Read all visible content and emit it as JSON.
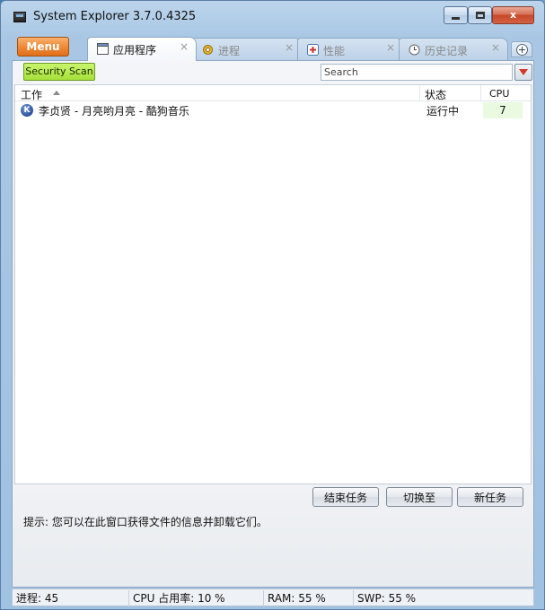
{
  "window": {
    "title": "System Explorer 3.7.0.4325",
    "controls": {
      "minimize": "",
      "maximize": "",
      "close": "x"
    }
  },
  "tabstrip": {
    "menu_label": "Menu",
    "tabs": [
      {
        "label": "应用程序",
        "icon": "app-window-icon",
        "active": true,
        "close": "×"
      },
      {
        "label": "进程",
        "icon": "gear-icon",
        "active": false,
        "close": "×"
      },
      {
        "label": "性能",
        "icon": "performance-icon",
        "active": false,
        "close": "×"
      },
      {
        "label": "历史记录",
        "icon": "clock-icon",
        "active": false,
        "close": "×"
      }
    ],
    "add_tab_icon": "plus-icon"
  },
  "toolbar": {
    "security_scan_label": "Security Scan",
    "search_placeholder": "Search",
    "download_icon": "red-arrow-down-icon"
  },
  "table": {
    "columns": {
      "work": "工作",
      "status": "状态",
      "cpu": "CPU"
    },
    "rows": [
      {
        "icon": "kugou-icon",
        "icon_letter": "K",
        "name": "李贞贤 - 月亮哟月亮 - 酷狗音乐",
        "status": "运行中",
        "cpu": "7"
      }
    ]
  },
  "actions": {
    "end_task": "结束任务",
    "switch_to": "切换至",
    "new_task": "新任务",
    "hint": "提示: 您可以在此窗口获得文件的信息并卸载它们。"
  },
  "statusbar": {
    "processes": "进程: 45",
    "cpu": "CPU 占用率: 10 %",
    "ram": "RAM: 55 %",
    "swp": "SWP: 55 %"
  },
  "colors": {
    "menu_button": "#ef8a36",
    "security_scan": "#a6e03a",
    "close_button": "#c5482a",
    "cpu_cell": "#e9fae0"
  }
}
